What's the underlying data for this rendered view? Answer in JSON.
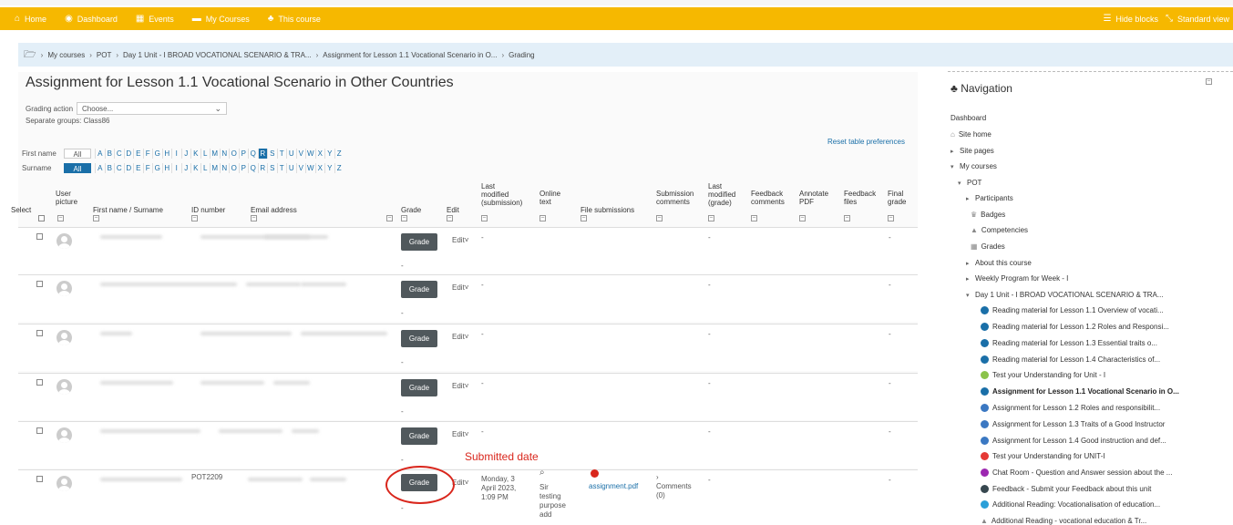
{
  "navbar": {
    "home": "Home",
    "dashboard": "Dashboard",
    "events": "Events",
    "my_courses": "My Courses",
    "this_course": "This course",
    "hide_blocks": "Hide blocks",
    "standard_view": "Standard view"
  },
  "breadcrumb": [
    "My courses",
    "POT",
    "Day 1 Unit - I BROAD VOCATIONAL SCENARIO & TRA...",
    "Assignment for Lesson 1.1 Vocational Scenario in O...",
    "Grading"
  ],
  "page_title": "Assignment for Lesson 1.1 Vocational Scenario in Other Countries",
  "grading_action": {
    "label": "Grading action",
    "value": "Choose..."
  },
  "separate_groups": "Separate groups: Class86",
  "reset_table": "Reset table preferences",
  "filters": {
    "first_name_label": "First name",
    "surname_label": "Surname",
    "all_label": "All",
    "letters": [
      "A",
      "B",
      "C",
      "D",
      "E",
      "F",
      "G",
      "H",
      "I",
      "J",
      "K",
      "L",
      "M",
      "N",
      "O",
      "P",
      "Q",
      "R",
      "S",
      "T",
      "U",
      "V",
      "W",
      "X",
      "Y",
      "Z"
    ],
    "first_name_selected": "R"
  },
  "columns": {
    "select": "Select",
    "user_picture": [
      "User",
      "picture"
    ],
    "name": "First name / Surname",
    "id_number": "ID number",
    "email": "Email address",
    "grade": "Grade",
    "edit": "Edit",
    "last_modified_submission": [
      "Last",
      "modified",
      "(submission)"
    ],
    "online_text": [
      "Online",
      "text"
    ],
    "file_submissions": "File submissions",
    "submission_comments": [
      "Submission",
      "comments"
    ],
    "last_modified_grade": [
      "Last",
      "modified",
      "(grade)"
    ],
    "feedback_comments": [
      "Feedback",
      "comments"
    ],
    "annotate_pdf": [
      "Annotate",
      "PDF"
    ],
    "feedback_files": [
      "Feedback",
      "files"
    ],
    "final_grade": [
      "Final",
      "grade"
    ]
  },
  "row_labels": {
    "grade_button": "Grade",
    "edit": "Edit",
    "dash": "-"
  },
  "last_row": {
    "id_number": "POT2209",
    "last_modified": [
      "Monday, 3",
      "April 2023,",
      "1:09 PM"
    ],
    "online_text": [
      "Sir",
      "testing",
      "purpose",
      "add"
    ],
    "file": "assignment.pdf",
    "comments": [
      "Comments",
      "(0)"
    ]
  },
  "annotation": "Submitted date",
  "navigation": {
    "title": "Navigation",
    "items": [
      "Dashboard",
      "Site home",
      "Site pages",
      "My courses",
      "POT",
      "Participants",
      "Badges",
      "Competencies",
      "Grades",
      "About this course",
      "Weekly Program for Week - I",
      "Day 1 Unit - I BROAD VOCATIONAL SCENARIO & TRA...",
      "Reading material for Lesson 1.1 Overview of vocati...",
      "Reading material for Lesson 1.2 Roles and Responsi...",
      "Reading material for Lesson 1.3 Essential traits o...",
      "Reading material for Lesson 1.4 Characteristics of...",
      "Test your Understanding for Unit - I",
      "Assignment for Lesson 1.1 Vocational Scenario in O...",
      "Assignment for Lesson 1.2 Roles and responsibilit...",
      "Assignment for Lesson 1.3 Traits of a Good Instructor",
      "Assignment for Lesson 1.4 Good instruction and def...",
      "Test your Understanding for UNIT-I",
      "Chat Room - Question and Answer session about the ...",
      "Feedback - Submit your Feedback about this unit",
      "Additional Reading: Vocationalisation of education...",
      "Additional Reading - vocational education & Tr..."
    ]
  },
  "colors": {
    "navbar": "#f6b800",
    "breadcrumb_bg": "#e3eff8",
    "link": "#1a6fa8",
    "grade_button": "#50585c",
    "annotation": "#d9261c"
  }
}
